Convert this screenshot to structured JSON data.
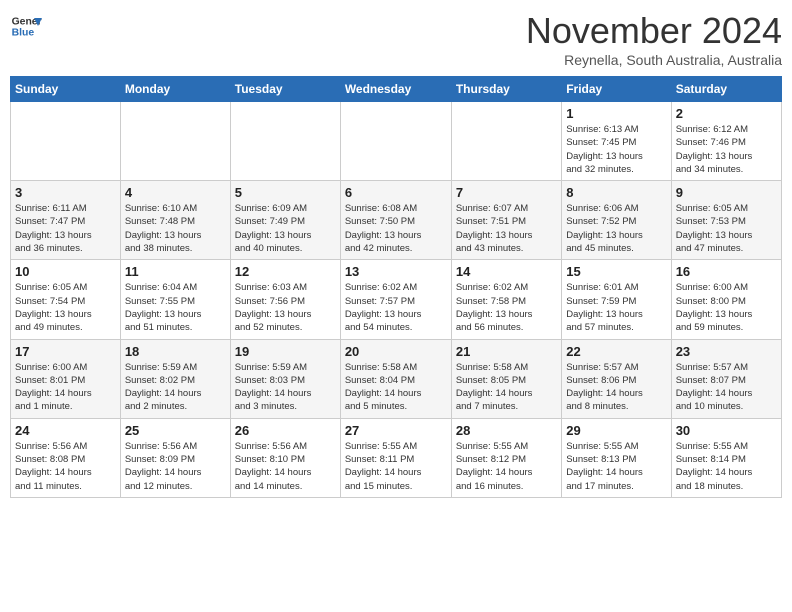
{
  "header": {
    "logo_line1": "General",
    "logo_line2": "Blue",
    "month": "November 2024",
    "location": "Reynella, South Australia, Australia"
  },
  "weekdays": [
    "Sunday",
    "Monday",
    "Tuesday",
    "Wednesday",
    "Thursday",
    "Friday",
    "Saturday"
  ],
  "weeks": [
    [
      {
        "day": "",
        "detail": ""
      },
      {
        "day": "",
        "detail": ""
      },
      {
        "day": "",
        "detail": ""
      },
      {
        "day": "",
        "detail": ""
      },
      {
        "day": "",
        "detail": ""
      },
      {
        "day": "1",
        "detail": "Sunrise: 6:13 AM\nSunset: 7:45 PM\nDaylight: 13 hours\nand 32 minutes."
      },
      {
        "day": "2",
        "detail": "Sunrise: 6:12 AM\nSunset: 7:46 PM\nDaylight: 13 hours\nand 34 minutes."
      }
    ],
    [
      {
        "day": "3",
        "detail": "Sunrise: 6:11 AM\nSunset: 7:47 PM\nDaylight: 13 hours\nand 36 minutes."
      },
      {
        "day": "4",
        "detail": "Sunrise: 6:10 AM\nSunset: 7:48 PM\nDaylight: 13 hours\nand 38 minutes."
      },
      {
        "day": "5",
        "detail": "Sunrise: 6:09 AM\nSunset: 7:49 PM\nDaylight: 13 hours\nand 40 minutes."
      },
      {
        "day": "6",
        "detail": "Sunrise: 6:08 AM\nSunset: 7:50 PM\nDaylight: 13 hours\nand 42 minutes."
      },
      {
        "day": "7",
        "detail": "Sunrise: 6:07 AM\nSunset: 7:51 PM\nDaylight: 13 hours\nand 43 minutes."
      },
      {
        "day": "8",
        "detail": "Sunrise: 6:06 AM\nSunset: 7:52 PM\nDaylight: 13 hours\nand 45 minutes."
      },
      {
        "day": "9",
        "detail": "Sunrise: 6:05 AM\nSunset: 7:53 PM\nDaylight: 13 hours\nand 47 minutes."
      }
    ],
    [
      {
        "day": "10",
        "detail": "Sunrise: 6:05 AM\nSunset: 7:54 PM\nDaylight: 13 hours\nand 49 minutes."
      },
      {
        "day": "11",
        "detail": "Sunrise: 6:04 AM\nSunset: 7:55 PM\nDaylight: 13 hours\nand 51 minutes."
      },
      {
        "day": "12",
        "detail": "Sunrise: 6:03 AM\nSunset: 7:56 PM\nDaylight: 13 hours\nand 52 minutes."
      },
      {
        "day": "13",
        "detail": "Sunrise: 6:02 AM\nSunset: 7:57 PM\nDaylight: 13 hours\nand 54 minutes."
      },
      {
        "day": "14",
        "detail": "Sunrise: 6:02 AM\nSunset: 7:58 PM\nDaylight: 13 hours\nand 56 minutes."
      },
      {
        "day": "15",
        "detail": "Sunrise: 6:01 AM\nSunset: 7:59 PM\nDaylight: 13 hours\nand 57 minutes."
      },
      {
        "day": "16",
        "detail": "Sunrise: 6:00 AM\nSunset: 8:00 PM\nDaylight: 13 hours\nand 59 minutes."
      }
    ],
    [
      {
        "day": "17",
        "detail": "Sunrise: 6:00 AM\nSunset: 8:01 PM\nDaylight: 14 hours\nand 1 minute."
      },
      {
        "day": "18",
        "detail": "Sunrise: 5:59 AM\nSunset: 8:02 PM\nDaylight: 14 hours\nand 2 minutes."
      },
      {
        "day": "19",
        "detail": "Sunrise: 5:59 AM\nSunset: 8:03 PM\nDaylight: 14 hours\nand 3 minutes."
      },
      {
        "day": "20",
        "detail": "Sunrise: 5:58 AM\nSunset: 8:04 PM\nDaylight: 14 hours\nand 5 minutes."
      },
      {
        "day": "21",
        "detail": "Sunrise: 5:58 AM\nSunset: 8:05 PM\nDaylight: 14 hours\nand 7 minutes."
      },
      {
        "day": "22",
        "detail": "Sunrise: 5:57 AM\nSunset: 8:06 PM\nDaylight: 14 hours\nand 8 minutes."
      },
      {
        "day": "23",
        "detail": "Sunrise: 5:57 AM\nSunset: 8:07 PM\nDaylight: 14 hours\nand 10 minutes."
      }
    ],
    [
      {
        "day": "24",
        "detail": "Sunrise: 5:56 AM\nSunset: 8:08 PM\nDaylight: 14 hours\nand 11 minutes."
      },
      {
        "day": "25",
        "detail": "Sunrise: 5:56 AM\nSunset: 8:09 PM\nDaylight: 14 hours\nand 12 minutes."
      },
      {
        "day": "26",
        "detail": "Sunrise: 5:56 AM\nSunset: 8:10 PM\nDaylight: 14 hours\nand 14 minutes."
      },
      {
        "day": "27",
        "detail": "Sunrise: 5:55 AM\nSunset: 8:11 PM\nDaylight: 14 hours\nand 15 minutes."
      },
      {
        "day": "28",
        "detail": "Sunrise: 5:55 AM\nSunset: 8:12 PM\nDaylight: 14 hours\nand 16 minutes."
      },
      {
        "day": "29",
        "detail": "Sunrise: 5:55 AM\nSunset: 8:13 PM\nDaylight: 14 hours\nand 17 minutes."
      },
      {
        "day": "30",
        "detail": "Sunrise: 5:55 AM\nSunset: 8:14 PM\nDaylight: 14 hours\nand 18 minutes."
      }
    ]
  ]
}
